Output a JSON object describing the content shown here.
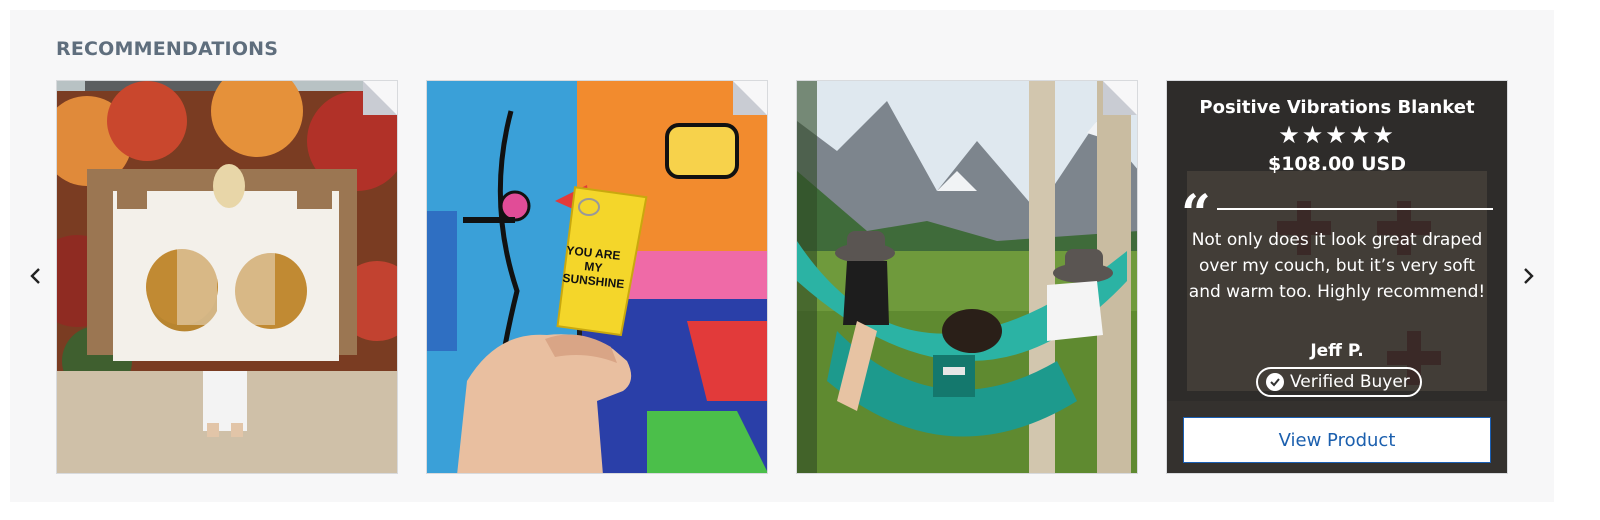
{
  "section": {
    "title": "RECOMMENDATIONS"
  },
  "carousel": {
    "prev_icon": "chevron-left-icon",
    "next_icon": "chevron-right-icon",
    "cards": [
      {
        "image": "person-holding-sun-moon-blanket-photo"
      },
      {
        "image": "you-are-my-sunshine-keychain-photo",
        "keychain_text": [
          "YOU ARE",
          "MY",
          "SUNSHINE"
        ]
      },
      {
        "image": "two-people-in-hammock-mountains-photo"
      },
      {
        "image": "blanket-photo-behind-review-overlay",
        "product_name": "Positive Vibrations Blanket",
        "rating": 5,
        "stars": "★★★★★",
        "price": "$108.00 USD",
        "review": "Not only does it look great draped over my couch, but it’s very soft and warm too. Highly recommend!",
        "author": "Jeff P.",
        "badge": "Verified Buyer",
        "button": "View Product"
      }
    ]
  },
  "colors": {
    "title": "#5f6e7d",
    "button_text": "#1b5fae",
    "overlay": "#282828"
  }
}
